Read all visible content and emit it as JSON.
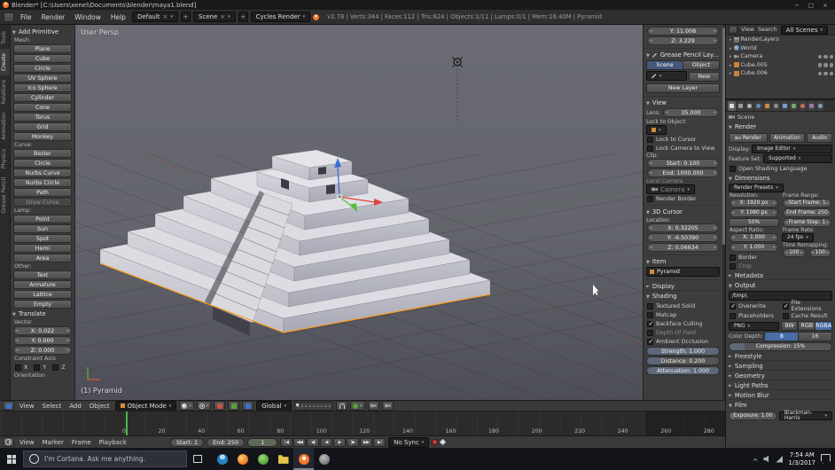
{
  "colors": {
    "accent_blue": "#4a6da8",
    "selection_orange": "#ff9a1e",
    "axis_x": "#e0433d",
    "axis_y": "#56c13a",
    "axis_z": "#3b6fd4",
    "playhead_green": "#4db34d"
  },
  "window": {
    "title": "Blender* [C:\\Users\\xenel\\Documents\\blender\\maya1.blend]",
    "minimize_icon": "−",
    "maximize_icon": "□",
    "close_icon": "×"
  },
  "menubar": {
    "menus": [
      "File",
      "Render",
      "Window",
      "Help"
    ],
    "layout_value": "Default",
    "scene_value": "Scene",
    "engine_value": "Cycles Render",
    "stats": "v2.78 | Verts:344 | Faces:112 | Tris:624 | Objects:1/11 | Lamps:0/1 | Mem:16.40M | Pyramid"
  },
  "toolshelf": {
    "tabs": [
      "Tools",
      "Create",
      "Relations",
      "Animation",
      "Physics",
      "Grease Pencil"
    ],
    "panel_title": "Add Primitive",
    "mesh_label": "Mesh:",
    "mesh_buttons": [
      "Plane",
      "Cube",
      "Circle",
      "UV Sphere",
      "Ico Sphere",
      "Cylinder",
      "Cone",
      "Torus",
      "Grid",
      "Monkey"
    ],
    "curve_label": "Curve:",
    "curve_buttons": [
      "Bezier",
      "Circle",
      "Nurbs Curve",
      "Nurbs Circle",
      "Path"
    ],
    "draw_curve": "Draw Curve",
    "lamp_label": "Lamp:",
    "lamp_buttons": [
      "Point",
      "Sun",
      "Spot",
      "Hemi",
      "Area"
    ],
    "other_label": "Other:",
    "other_buttons": [
      "Text",
      "Armature",
      "Lattice",
      "Empty"
    ],
    "translate_title": "Translate",
    "vector_label": "Vector",
    "vector_x": "X: 0.022",
    "vector_y": "Y: 0.000",
    "vector_z": "Z: 0.000",
    "constraint_label": "Constraint Axis",
    "axis_labels": [
      "X",
      "Y",
      "Z"
    ],
    "orientation_label": "Orientation"
  },
  "viewport": {
    "view_label": "User Persp",
    "object_label": "(1) Pyramid"
  },
  "viewport_header": {
    "menus": [
      "View",
      "Select",
      "Add",
      "Object"
    ],
    "mode_value": "Object Mode",
    "orientation_value": "Global"
  },
  "npanel": {
    "transform": {
      "y_field": "Y: 11.008",
      "z_field": "Z: 3.229"
    },
    "grease": {
      "title": "Grease Pencil Lay...",
      "scene_btn": "Scene",
      "object_btn": "Object",
      "new_btn": "New",
      "new_layer_btn": "New Layer"
    },
    "view": {
      "title": "View",
      "lens_label": "Lens:",
      "lens_value": "35.000",
      "lock_object_label": "Lock to Object:",
      "lock_cursor": "Lock to Cursor",
      "lock_camera": "Lock Camera to View",
      "clip_label": "Clip:",
      "clip_start": "Start: 0.100",
      "clip_end": "End: 1000.000",
      "local_camera_label": "Local Camera",
      "local_camera_value": "Camera",
      "render_border": "Render Border"
    },
    "cursor": {
      "title": "3D Cursor",
      "location_label": "Location:",
      "x": "X: 0.32205",
      "y": "Y: -6.50390",
      "z": "Z: 0.06634"
    },
    "item": {
      "title": "Item",
      "name": "Pyramid"
    },
    "display_title": "Display",
    "shading": {
      "title": "Shading",
      "textured_solid": "Textured Solid",
      "matcap": "Matcap",
      "backface": "Backface Culling",
      "dof": "Depth Of Field",
      "ao": "Ambient Occlusion",
      "strength": "Strength: 1.000",
      "distance": "Distance: 0.200",
      "attenuation": "Attenuation: 1.000"
    }
  },
  "outliner": {
    "header": {
      "view": "View",
      "search": "Search",
      "scenes": "All Scenes"
    },
    "rows": [
      {
        "name": "RenderLayers"
      },
      {
        "name": "World"
      },
      {
        "name": "Camera"
      },
      {
        "name": "Cube.005"
      },
      {
        "name": "Cube.006"
      }
    ]
  },
  "properties": {
    "context_label": "Scene",
    "render": {
      "title": "Render",
      "render_btn": "Render",
      "animation_btn": "Animation",
      "audio_btn": "Audio",
      "display_label": "Display:",
      "display_value": "Image Editor",
      "feature_label": "Feature Set:",
      "feature_value": "Supported",
      "osl": "Open Shading Language"
    },
    "dimensions": {
      "title": "Dimensions",
      "presets": "Render Presets",
      "resolution_label": "Resolution:",
      "res_x": "X: 1920 px",
      "res_y": "Y: 1080 px",
      "res_pct": "50%",
      "frame_range_label": "Frame Range:",
      "start": "Start Frame: 1",
      "end": "End Frame: 250",
      "step": "Frame Step: 1",
      "aspect_label": "Aspect Ratio:",
      "aspect_x": "X: 1.000",
      "aspect_y": "Y: 1.000",
      "fps_label": "Frame Rate:",
      "fps_value": "24 fps",
      "remap_label": "Time Remapping:",
      "remap_old": "100",
      "remap_new": "100",
      "border": "Border",
      "crop": "Crop"
    },
    "metadata_title": "Metadata",
    "output": {
      "title": "Output",
      "path": "/tmp\\",
      "overwrite": "Overwrite",
      "file_ext": "File Extensions",
      "placeholders": "Placeholders",
      "cache": "Cache Result",
      "format": "PNG",
      "bw": "BW",
      "rgb": "RGB",
      "rgba": "RGBA",
      "depth_label": "Color Depth:",
      "depth_8": "8",
      "depth_16": "16",
      "compression": "Compression: 15%"
    },
    "collapsed": [
      "Freestyle",
      "Sampling",
      "Geometry",
      "Light Paths",
      "Motion Blur"
    ],
    "film": {
      "title": "Film",
      "exposure": "Exposure: 1.00",
      "filter": "Blackman-Harris"
    }
  },
  "timeline": {
    "ruler_labels": [
      "0",
      "20",
      "40",
      "60",
      "80",
      "100",
      "120",
      "140",
      "160",
      "180",
      "200",
      "220",
      "240",
      "260",
      "280"
    ],
    "menus": [
      "View",
      "Marker",
      "Frame",
      "Playback"
    ],
    "start_field": "Start: 1",
    "end_field": "End: 250",
    "current_frame": "1",
    "playback_icons": [
      "|◀",
      "◀◀",
      "◀|",
      "◀",
      "▶",
      "|▶",
      "▶▶",
      "▶|"
    ],
    "sync_value": "No Sync"
  },
  "taskbar": {
    "cortana_text": "I'm Cortana. Ask me anything.",
    "tray_time": "7:54 AM",
    "tray_date": "1/3/2017"
  }
}
